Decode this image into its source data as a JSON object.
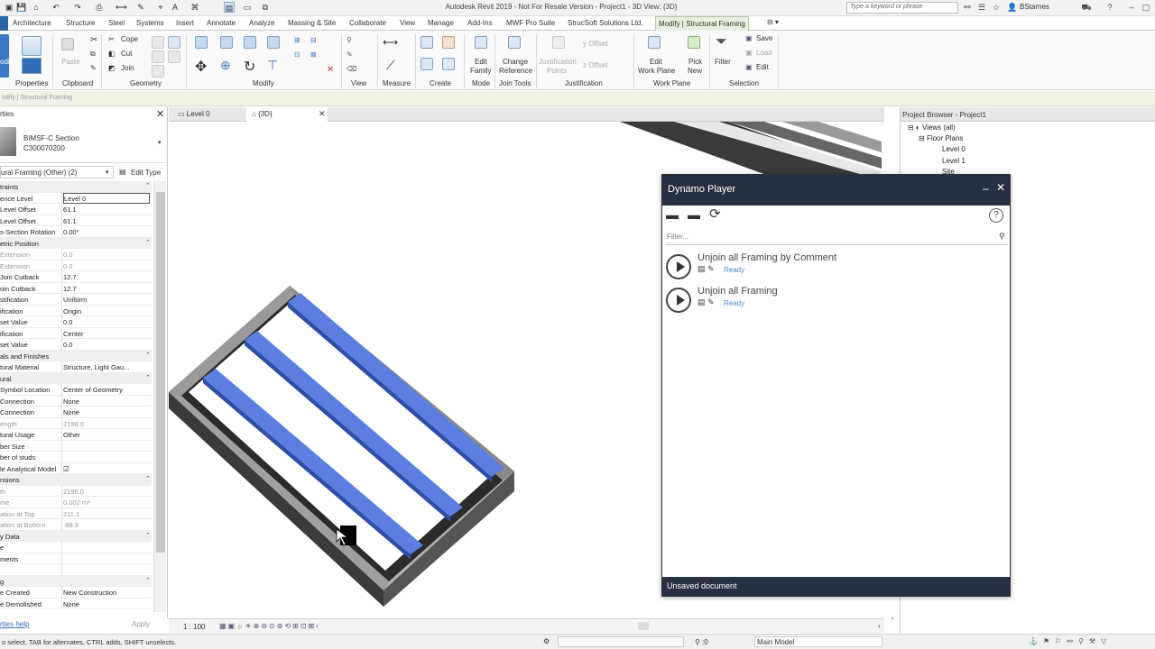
{
  "app": {
    "title": "Autodesk Revit 2019 - Not For Resale Version - Project1 - 3D View: {3D}",
    "search_placeholder": "Type a keyword or phrase",
    "user": "BStarnes"
  },
  "tabs": [
    "Architecture",
    "Structure",
    "Steel",
    "Systems",
    "Insert",
    "Annotate",
    "Analyze",
    "Massing & Site",
    "Collaborate",
    "View",
    "Manage",
    "Add-Ins",
    "MWF Pro Suite",
    "StrucSoft Solutions Ltd.",
    "Modify | Structural Framing"
  ],
  "ribbon": {
    "modify_label": "odify",
    "paste": "Paste",
    "cope": "Cope",
    "cut": "Cut",
    "join": "Join",
    "edit_family": [
      "Edit",
      "Family"
    ],
    "change_reference": [
      "Change",
      "Reference"
    ],
    "justification_points": [
      "Justification",
      "Points"
    ],
    "y_offset": "y Offset",
    "z_offset": "z Offset",
    "edit_work_plane": [
      "Edit",
      "Work Plane"
    ],
    "pick_new": [
      "Pick",
      "New"
    ],
    "filter": "Filter",
    "save": "Save",
    "load": "Load",
    "edit": "Edit",
    "panels": [
      "Properties",
      "Clipboard",
      "Geometry",
      "Modify",
      "View",
      "Measure",
      "Create",
      "Mode",
      "Join Tools",
      "Justification",
      "Work Plane",
      "Selection"
    ]
  },
  "context_bar": "odify | Structural Framing",
  "properties": {
    "header": "rties",
    "type_name": "BIMSF-C Section",
    "type_sub": "C300070200",
    "selector": "ural Framing (Other) (2)",
    "edit_type": "Edit Type",
    "rows": [
      {
        "k": "traints",
        "v": "",
        "group": true
      },
      {
        "k": "ence Level",
        "v": "Level 0",
        "boxed": true
      },
      {
        "k": "Level Offset",
        "v": "61.1"
      },
      {
        "k": "Level Offset",
        "v": "61.1"
      },
      {
        "k": "s-Section Rotation",
        "v": "0.00°"
      },
      {
        "k": "etric Position",
        "v": "",
        "group": true
      },
      {
        "k": "Extension",
        "v": "0.0",
        "grey": true
      },
      {
        "k": "Extension",
        "v": "0.0",
        "grey": true
      },
      {
        "k": "Join Cutback",
        "v": "12.7"
      },
      {
        "k": "oin Cutback",
        "v": "12.7"
      },
      {
        "k": "stification",
        "v": "Uniform"
      },
      {
        "k": "ification",
        "v": "Origin"
      },
      {
        "k": "set Value",
        "v": "0.0"
      },
      {
        "k": "ification",
        "v": "Center"
      },
      {
        "k": "set Value",
        "v": "0.0"
      },
      {
        "k": "als and Finishes",
        "v": "",
        "group": true
      },
      {
        "k": "tural Material",
        "v": "Structure, Light Gau..."
      },
      {
        "k": "ural",
        "v": "",
        "group": true
      },
      {
        "k": "Symbol Location",
        "v": "Center of Geometry"
      },
      {
        "k": "Connection",
        "v": "None"
      },
      {
        "k": "Connection",
        "v": "None"
      },
      {
        "k": "ength",
        "v": "2196.0",
        "grey": true
      },
      {
        "k": "tural Usage",
        "v": "Other"
      },
      {
        "k": "ber Size",
        "v": ""
      },
      {
        "k": "ber of studs",
        "v": ""
      },
      {
        "k": "le Analytical Model",
        "v": "☑"
      },
      {
        "k": "nsions",
        "v": "",
        "group": true
      },
      {
        "k": "th",
        "v": "2196.0",
        "grey": true
      },
      {
        "k": "me",
        "v": "0.002 m³",
        "grey": true
      },
      {
        "k": "ation at Top",
        "v": "211.1",
        "grey": true
      },
      {
        "k": "ation at Bottom",
        "v": "-88.9",
        "grey": true
      },
      {
        "k": "y Data",
        "v": "",
        "group": true
      },
      {
        "k": "e",
        "v": ""
      },
      {
        "k": "ments",
        "v": ""
      },
      {
        "k": "",
        "v": ""
      },
      {
        "k": "g",
        "v": "",
        "group": true
      },
      {
        "k": "e Created",
        "v": "New Construction"
      },
      {
        "k": "e Demolished",
        "v": "None"
      }
    ],
    "help": "rties help",
    "apply": "Apply"
  },
  "views": {
    "tabs": [
      "Level 0",
      "{3D}"
    ],
    "scale": "1 : 100"
  },
  "project_browser": {
    "title": "Project Browser - Project1",
    "items": [
      "Views (all)",
      "Floor Plans",
      "Level 0",
      "Level 1",
      "Site"
    ]
  },
  "dynamo": {
    "title": "Dynamo Player",
    "filter_placeholder": "Filter...",
    "scripts": [
      {
        "name": "Unjoin all Framing by Comment",
        "status": "Ready"
      },
      {
        "name": "Unjoin all Framing",
        "status": "Ready"
      }
    ],
    "footer": "Unsaved document"
  },
  "status": {
    "text": "o select, TAB for alternates, CTRL adds, SHIFT unselects.",
    "zero": ":0",
    "model": "Main Model"
  },
  "colors": {
    "accent": "#273041",
    "beam_blue": "#5b7fe0",
    "ctx_green": "#eef3e6"
  }
}
